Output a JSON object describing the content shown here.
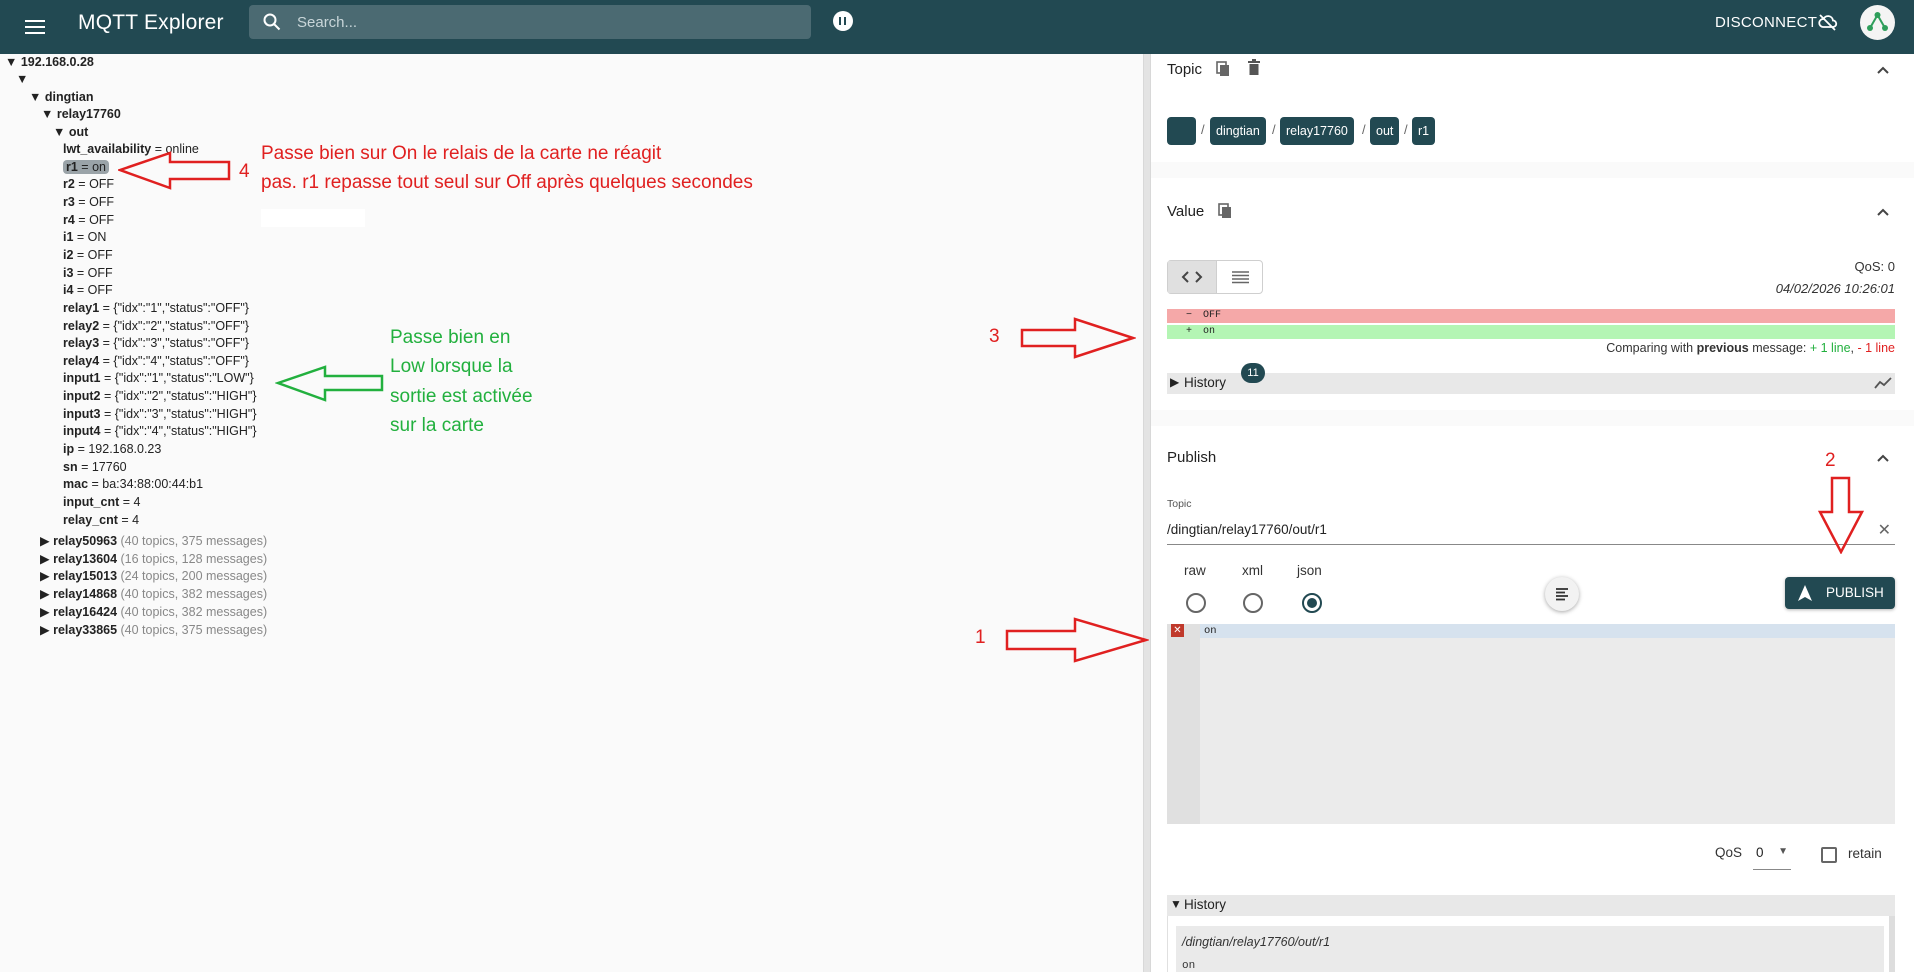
{
  "app": {
    "title": "MQTT Explorer",
    "search_placeholder": "Search...",
    "disconnect_label": "DISCONNECT",
    "accent": "#224952"
  },
  "tree": {
    "host": "192.168.0.28",
    "empty_root": "",
    "dingtian": "dingtian",
    "relay": "relay17760",
    "out": "out",
    "items": [
      {
        "key": "lwt_availability",
        "val": " = online"
      },
      {
        "key": "r1",
        "val": " = on"
      },
      {
        "key": "r2",
        "val": " = OFF"
      },
      {
        "key": "r3",
        "val": " = OFF"
      },
      {
        "key": "r4",
        "val": " = OFF"
      },
      {
        "key": "i1",
        "val": " = ON"
      },
      {
        "key": "i2",
        "val": " = OFF"
      },
      {
        "key": "i3",
        "val": " = OFF"
      },
      {
        "key": "i4",
        "val": " = OFF"
      },
      {
        "key": "relay1",
        "val": " = {\"idx\":\"1\",\"status\":\"OFF\"}"
      },
      {
        "key": "relay2",
        "val": " = {\"idx\":\"2\",\"status\":\"OFF\"}"
      },
      {
        "key": "relay3",
        "val": " = {\"idx\":\"3\",\"status\":\"OFF\"}"
      },
      {
        "key": "relay4",
        "val": " = {\"idx\":\"4\",\"status\":\"OFF\"}"
      },
      {
        "key": "input1",
        "val": " = {\"idx\":\"1\",\"status\":\"LOW\"}"
      },
      {
        "key": "input2",
        "val": " = {\"idx\":\"2\",\"status\":\"HIGH\"}"
      },
      {
        "key": "input3",
        "val": " = {\"idx\":\"3\",\"status\":\"HIGH\"}"
      },
      {
        "key": "input4",
        "val": " = {\"idx\":\"4\",\"status\":\"HIGH\"}"
      },
      {
        "key": "ip",
        "val": " = 192.168.0.23"
      },
      {
        "key": "sn",
        "val": " = 17760"
      },
      {
        "key": "mac",
        "val": " = ba:34:88:00:44:b1"
      },
      {
        "key": "input_cnt",
        "val": " = 4"
      },
      {
        "key": "relay_cnt",
        "val": " = 4"
      }
    ],
    "collapsed": [
      {
        "name": "relay50963",
        "meta": " (40 topics, 375 messages)"
      },
      {
        "name": "relay13604",
        "meta": " (16 topics, 128 messages)"
      },
      {
        "name": "relay15013",
        "meta": " (24 topics, 200 messages)"
      },
      {
        "name": "relay14868",
        "meta": " (40 topics, 382 messages)"
      },
      {
        "name": "relay16424",
        "meta": " (40 topics, 382 messages)"
      },
      {
        "name": "relay33865",
        "meta": " (40 topics, 375 messages)"
      }
    ]
  },
  "annotations": {
    "note4_line1": "Passe bien sur On le relais de la carte ne réagit",
    "note4_line2": "pas. r1 repasse tout seul sur Off après quelques  secondes",
    "num4": "4",
    "green_lines": [
      "Passe bien en",
      "Low lorsque la",
      "sortie est activée",
      "sur la carte"
    ],
    "num3": "3",
    "num2": "2",
    "num1": "1",
    "red": "#e02020",
    "green": "#22b03e"
  },
  "topic": {
    "label": "Topic",
    "crumbs": [
      "",
      "dingtian",
      "relay17760",
      "out",
      "r1"
    ],
    "sep": "/"
  },
  "value": {
    "label": "Value",
    "qos": "QoS: 0",
    "timestamp": "04/02/2026 10:26:01",
    "diff_removed": "OFF",
    "diff_added": "on",
    "compare_prefix": "Comparing with ",
    "compare_bold": "previous",
    "compare_mid": " message: ",
    "compare_added": "+ 1 line",
    "compare_comma": ", ",
    "compare_removed": "- 1 line",
    "history_label": "History",
    "history_count": "11"
  },
  "publish": {
    "label": "Publish",
    "topic_label": "Topic",
    "topic_value": "/dingtian/relay17760/out/r1",
    "formats": [
      "raw",
      "xml",
      "json"
    ],
    "selected_format": "json",
    "button_label": "PUBLISH",
    "editor_text": "on",
    "qos_label": "QoS",
    "qos_value": "0",
    "retain_label": "retain",
    "history_label": "History",
    "history_topic": "/dingtian/relay17760/out/r1",
    "history_value": "on"
  }
}
